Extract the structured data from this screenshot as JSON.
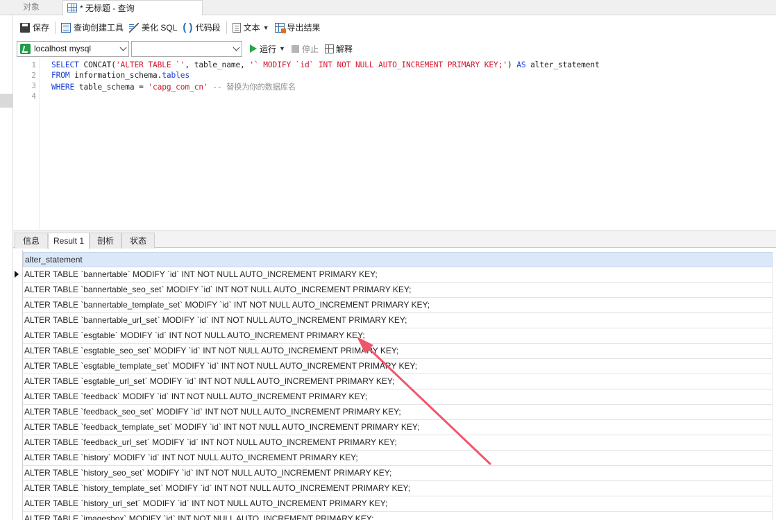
{
  "tabs": {
    "objects": "对象",
    "query": "* 无标题 - 查询"
  },
  "toolbar": {
    "save": "保存",
    "query_builder": "查询创建工具",
    "beautify": "美化 SQL",
    "snippet": "代码段",
    "text": "文本",
    "export": "导出结果"
  },
  "connection": {
    "selected": "localhost mysql",
    "database": "",
    "run": "运行",
    "stop": "停止",
    "explain": "解释"
  },
  "editor": {
    "line_numbers": [
      "1",
      "2",
      "3",
      "4"
    ],
    "line1": {
      "p1": "SELECT",
      "p2": " CONCAT(",
      "p3": "'ALTER TABLE `'",
      "p4": ", table_name, ",
      "p5": "'` MODIFY `id` INT NOT NULL AUTO_INCREMENT PRIMARY KEY;'",
      "p6": ") ",
      "p7": "AS",
      "p8": " alter_statement"
    },
    "line2": {
      "p1": "FROM",
      "p2": " information_schema.",
      "p3": "tables"
    },
    "line3": {
      "p1": "WHERE",
      "p2": " table_schema = ",
      "p3": "'capg_com_cn'",
      "p4": " -- 替换为你的数据库名"
    }
  },
  "result_tabs": [
    "信息",
    "Result 1",
    "剖析",
    "状态"
  ],
  "grid": {
    "column": "alter_statement",
    "rows": [
      "ALTER TABLE `bannertable` MODIFY `id` INT NOT NULL AUTO_INCREMENT PRIMARY KEY;",
      "ALTER TABLE `bannertable_seo_set` MODIFY `id` INT NOT NULL AUTO_INCREMENT PRIMARY KEY;",
      "ALTER TABLE `bannertable_template_set` MODIFY `id` INT NOT NULL AUTO_INCREMENT PRIMARY KEY;",
      "ALTER TABLE `bannertable_url_set` MODIFY `id` INT NOT NULL AUTO_INCREMENT PRIMARY KEY;",
      "ALTER TABLE `esgtable` MODIFY `id` INT NOT NULL AUTO_INCREMENT PRIMARY KEY;",
      "ALTER TABLE `esgtable_seo_set` MODIFY `id` INT NOT NULL AUTO_INCREMENT PRIMARY KEY;",
      "ALTER TABLE `esgtable_template_set` MODIFY `id` INT NOT NULL AUTO_INCREMENT PRIMARY KEY;",
      "ALTER TABLE `esgtable_url_set` MODIFY `id` INT NOT NULL AUTO_INCREMENT PRIMARY KEY;",
      "ALTER TABLE `feedback` MODIFY `id` INT NOT NULL AUTO_INCREMENT PRIMARY KEY;",
      "ALTER TABLE `feedback_seo_set` MODIFY `id` INT NOT NULL AUTO_INCREMENT PRIMARY KEY;",
      "ALTER TABLE `feedback_template_set` MODIFY `id` INT NOT NULL AUTO_INCREMENT PRIMARY KEY;",
      "ALTER TABLE `feedback_url_set` MODIFY `id` INT NOT NULL AUTO_INCREMENT PRIMARY KEY;",
      "ALTER TABLE `history` MODIFY `id` INT NOT NULL AUTO_INCREMENT PRIMARY KEY;",
      "ALTER TABLE `history_seo_set` MODIFY `id` INT NOT NULL AUTO_INCREMENT PRIMARY KEY;",
      "ALTER TABLE `history_template_set` MODIFY `id` INT NOT NULL AUTO_INCREMENT PRIMARY KEY;",
      "ALTER TABLE `history_url_set` MODIFY `id` INT NOT NULL AUTO_INCREMENT PRIMARY KEY;",
      "ALTER TABLE `imagesbox` MODIFY `id` INT NOT NULL AUTO_INCREMENT PRIMARY KEY;"
    ]
  },
  "annotation_color": "#f0566a"
}
